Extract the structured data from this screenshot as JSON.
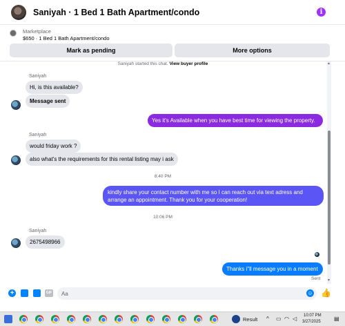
{
  "header": {
    "title": "Saniyah · 1 Bed 1 Bath Apartment/condo",
    "info_icon": "info-icon"
  },
  "listing": {
    "source": "Marketplace",
    "detail": "$650 · 1 Bed 1 Bath Apartment/condo",
    "buttons": {
      "pending": "Mark as pending",
      "more": "More options"
    }
  },
  "thread": {
    "system_note_prefix": "Saniyah started this chat.",
    "system_note_link": "View buyer profile",
    "messages": [
      {
        "sender": "Saniyah",
        "text": "Hi, is this available?"
      },
      {
        "text": "Message sent"
      },
      {
        "text": "Yes it's Available when you have best time for viewing the property."
      },
      {
        "sender": "Saniyah",
        "text": "would friday work ?"
      },
      {
        "text": "also what's the requirements for this rental listing may i ask"
      },
      {
        "timestamp": "8:40 PM"
      },
      {
        "text": "kindly share your contact number with me so I can reach out via text adress and arrange an appointment. Thank you for your cooperation!"
      },
      {
        "timestamp": "10:06 PM"
      },
      {
        "sender": "Saniyah",
        "text": "2675498966"
      },
      {
        "text": "Thanks i\"ll message you in a moment"
      },
      {
        "status": "Sent"
      }
    ]
  },
  "composer": {
    "placeholder": "Aa",
    "icons": [
      "plus-icon",
      "photo-icon",
      "sticker-icon",
      "gif-icon",
      "emoji-icon",
      "like-icon"
    ],
    "gif_label": "GIF"
  },
  "taskbar": {
    "app_label": "Result",
    "time": "10:07 PM",
    "date": "3/27/2025"
  },
  "colors": {
    "accent_purple": "#8a2be2",
    "accent_blue": "#0084ff",
    "bubble_gray": "#e4e6eb"
  }
}
